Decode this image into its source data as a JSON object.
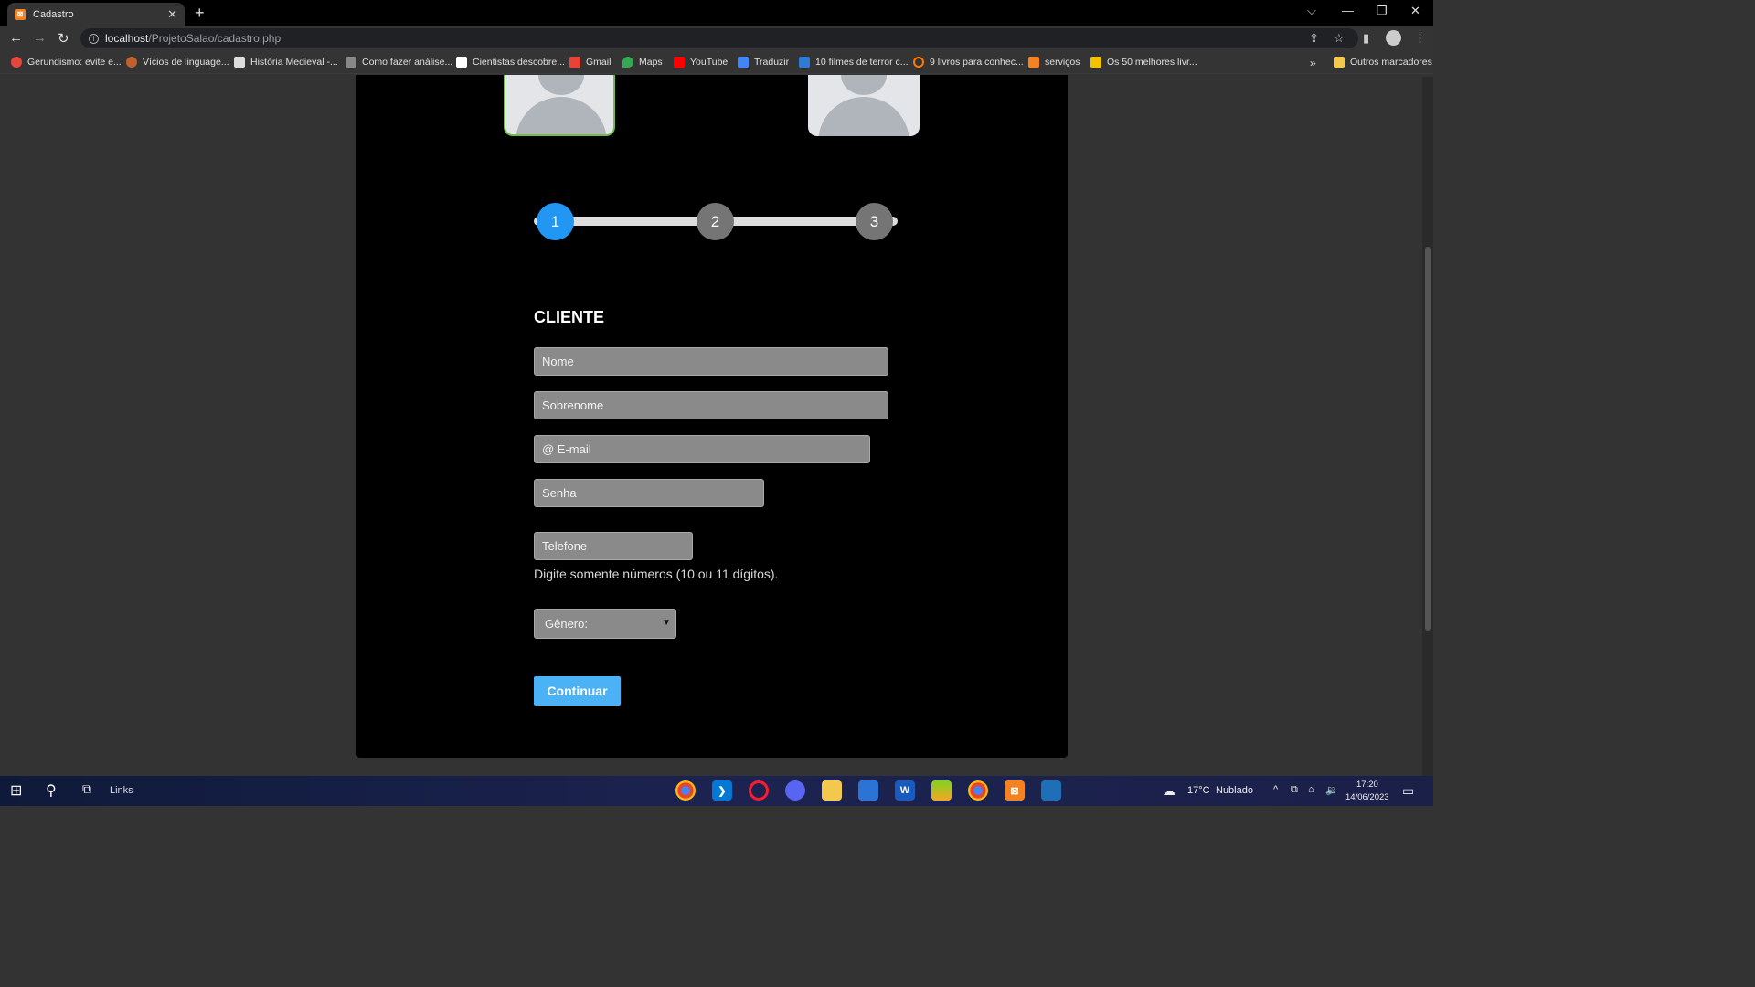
{
  "browser": {
    "tab_title": "Cadastro",
    "tab_favicon": "xampp-icon",
    "url_host": "localhost",
    "url_path": "/ProjetoSalao/cadastro.php"
  },
  "bookmarks": [
    {
      "label": "Gerundismo: evite e...",
      "color": "#e8453c"
    },
    {
      "label": "Vícios de linguage...",
      "color": "#c0602c"
    },
    {
      "label": "História Medieval -...",
      "color": "#dddddd"
    },
    {
      "label": "Como fazer análise...",
      "color": "#888888"
    },
    {
      "label": "Cientistas descobre...",
      "color": "#ffffff"
    },
    {
      "label": "Gmail",
      "color": "#ea4335"
    },
    {
      "label": "Maps",
      "color": "#34a853"
    },
    {
      "label": "YouTube",
      "color": "#ff0000"
    },
    {
      "label": "Traduzir",
      "color": "#4285f4"
    },
    {
      "label": "10 filmes de terror c...",
      "color": "#2e7bd6"
    },
    {
      "label": "9 livros para conhec...",
      "color": "#ff7a00"
    },
    {
      "label": "serviços",
      "color": "#f58220"
    },
    {
      "label": "Os 50 melhores livr...",
      "color": "#f2c200"
    }
  ],
  "bookmarks_other": "Outros marcadores",
  "form": {
    "steps": [
      "1",
      "2",
      "3"
    ],
    "active_step": 1,
    "title": "CLIENTE",
    "placeholders": {
      "nome": "Nome",
      "sobrenome": "Sobrenome",
      "email": "@ E-mail",
      "senha": "Senha",
      "telefone": "Telefone"
    },
    "telefone_hint": "Digite somente números (10 ou 11 dígitos).",
    "genero_selected": "Gênero:",
    "continue_label": "Continuar",
    "colors": {
      "active_step": "#2196f3",
      "inactive_step": "#757575",
      "button": "#4bb3f5"
    }
  },
  "taskbar": {
    "links_label": "Links",
    "weather_temp": "17°C",
    "weather_text": "Nublado",
    "time": "17:20",
    "date": "14/06/2023"
  }
}
